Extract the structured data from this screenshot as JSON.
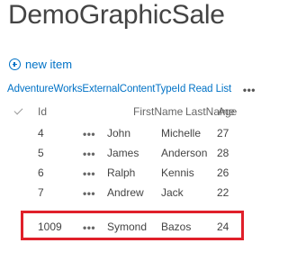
{
  "page": {
    "title": "DemoGraphicSale"
  },
  "toolbar": {
    "new_item_label": "new item",
    "new_item_icon": "plus-circle-icon"
  },
  "view": {
    "name": "AdventureWorksExternalContentTypeId Read List",
    "more_label": "•••"
  },
  "list": {
    "columns": {
      "check": "✓",
      "id": "Id",
      "first_name": "FirstName",
      "last_name": "LastName",
      "age": "Age"
    },
    "item_menu_label": "•••",
    "rows": [
      {
        "id": "4",
        "first_name": "John",
        "last_name": "Michelle",
        "age": "27"
      },
      {
        "id": "5",
        "first_name": "James",
        "last_name": "Anderson",
        "age": "28"
      },
      {
        "id": "6",
        "first_name": "Ralph",
        "last_name": "Kennis",
        "age": "26"
      },
      {
        "id": "7",
        "first_name": "Andrew",
        "last_name": "Jack",
        "age": "22"
      },
      {
        "id": "1009",
        "first_name": "Symond",
        "last_name": "Bazos",
        "age": "24"
      }
    ],
    "highlighted_row_index": 4,
    "highlight_color": "#e0202a",
    "accent_color": "#0072c6"
  }
}
